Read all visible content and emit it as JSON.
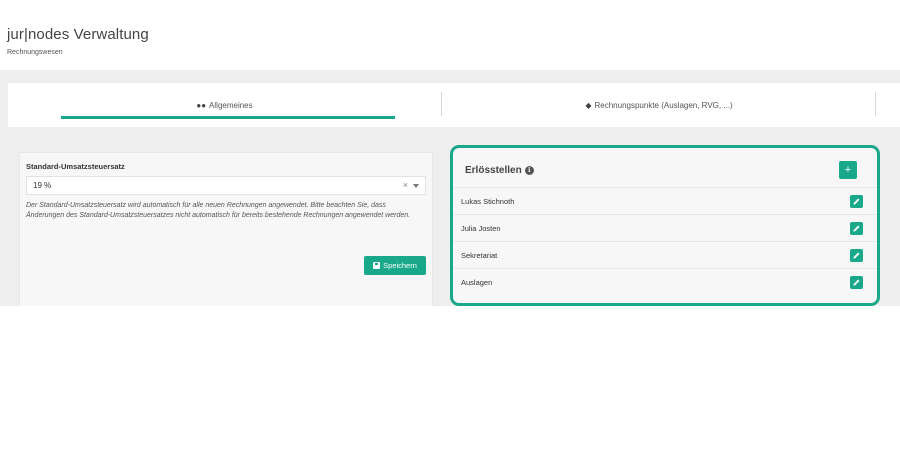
{
  "header": {
    "title": "jur|nodes Verwaltung",
    "subtitle": "Rechnungswesen"
  },
  "tabs": [
    {
      "label": "Allgemeines",
      "icon": "users-icon",
      "active": true
    },
    {
      "label": "Rechnungspunkte (Auslagen, RVG, ...)",
      "icon": "cubes-icon",
      "active": false
    }
  ],
  "vat": {
    "label": "Standard-Umsatzsteuersatz",
    "selected_value": "19 %",
    "clear_symbol": "×",
    "hint": "Der Standard-Umsatzsteuersatz wird automatisch für alle neuen Rechnungen angewendet. Bitte beachten Sie, dass Änderungen des Standard-Umsatzsteuersatzes nicht automatisch für bereits bestehende Rechnungen angewendet werden.",
    "save_label": "Speichern"
  },
  "revenue_centers": {
    "title": "Erlösstellen",
    "info_symbol": "i",
    "add_symbol": "+",
    "items": [
      {
        "name": "Lukas Stichnoth"
      },
      {
        "name": "Julia Josten"
      },
      {
        "name": "Sekretariat"
      },
      {
        "name": "Auslagen"
      }
    ]
  },
  "colors": {
    "accent": "#1aa88a",
    "band": "#eeeeee"
  }
}
